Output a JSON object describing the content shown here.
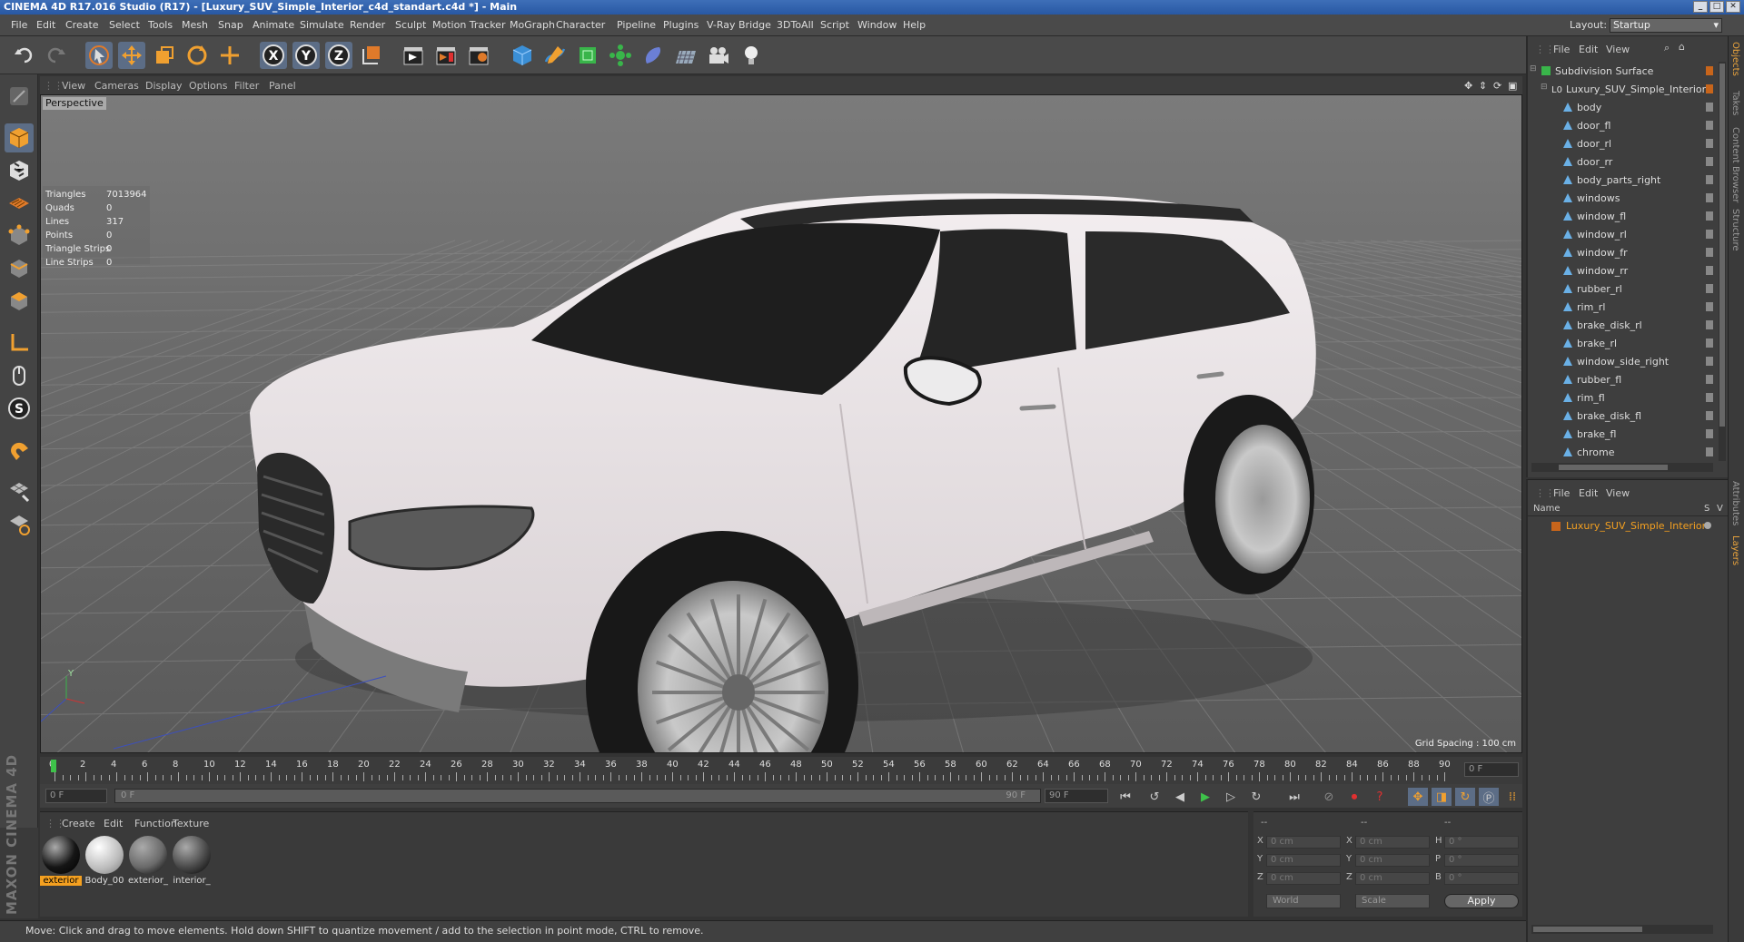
{
  "window": {
    "title": "CINEMA 4D R17.016 Studio (R17) - [Luxury_SUV_Simple_Interior_c4d_standart.c4d *] - Main",
    "min": "_",
    "max": "□",
    "close": "✕"
  },
  "menu": {
    "items": [
      "File",
      "Edit",
      "Create",
      "Select",
      "Tools",
      "Mesh",
      "Snap",
      "Animate",
      "Simulate",
      "Render",
      "Sculpt",
      "Motion Tracker",
      "MoGraph",
      "Character",
      "Pipeline",
      "Plugins",
      "V-Ray Bridge",
      "3DToAll",
      "Script",
      "Window",
      "Help"
    ],
    "layout_label": "Layout:",
    "layout_value": "Startup"
  },
  "toolbar": {
    "icons": [
      "undo-icon",
      "redo-icon",
      "live-selection-icon",
      "move-icon",
      "scale-icon",
      "rotate-icon",
      "last-tool-icon",
      "x-axis-icon",
      "y-axis-icon",
      "z-axis-icon",
      "coordinate-system-icon",
      "render-view-icon",
      "render-picture-viewer-icon",
      "edit-render-settings-icon",
      "cube-icon",
      "pen-spline-icon",
      "subdivision-surface-icon",
      "cloner-icon",
      "deformer-icon",
      "floor-icon",
      "camera-icon",
      "light-icon"
    ],
    "x_label": "X",
    "y_label": "Y",
    "z_label": "Z"
  },
  "viewport_menu": [
    "View",
    "Cameras",
    "Display",
    "Options",
    "Filter",
    "Panel"
  ],
  "viewport": {
    "label": "Perspective",
    "stats": [
      {
        "name": "Triangles",
        "value": "7013964"
      },
      {
        "name": "Quads",
        "value": "0"
      },
      {
        "name": "Lines",
        "value": "317"
      },
      {
        "name": "Points",
        "value": "0"
      },
      {
        "name": "Triangle Strips",
        "value": "0"
      },
      {
        "name": "Line Strips",
        "value": "0"
      }
    ],
    "grid_spacing": "Grid Spacing : 100 cm",
    "axis_y": "Y"
  },
  "timeline": {
    "ticks": [
      "0",
      "2",
      "4",
      "6",
      "8",
      "10",
      "12",
      "14",
      "16",
      "18",
      "20",
      "22",
      "24",
      "26",
      "28",
      "30",
      "32",
      "34",
      "36",
      "38",
      "40",
      "42",
      "44",
      "46",
      "48",
      "50",
      "52",
      "54",
      "56",
      "58",
      "60",
      "62",
      "64",
      "66",
      "68",
      "70",
      "72",
      "74",
      "76",
      "78",
      "80",
      "82",
      "84",
      "86",
      "88",
      "90"
    ],
    "current_frame": "0 F"
  },
  "playbar": {
    "start": "0 F",
    "slider_start": "0 F",
    "slider_end": "90 F",
    "end": "90 F"
  },
  "material_menu": [
    "Create",
    "Edit",
    "Function",
    "Texture"
  ],
  "materials": [
    {
      "name": "exterior",
      "color": "#151515",
      "selected": true
    },
    {
      "name": "Body_00",
      "color": "#e4e4e4",
      "selected": false
    },
    {
      "name": "exterior_",
      "color": "#6a6a6a",
      "selected": false
    },
    {
      "name": "interior_",
      "color": "#4a4a4a",
      "selected": false
    }
  ],
  "coords": {
    "header": [
      "--",
      "--",
      "--"
    ],
    "rows": [
      {
        "a": "X",
        "av": "0 cm",
        "b": "X",
        "bv": "0 cm",
        "c": "H",
        "cv": "0 °"
      },
      {
        "a": "Y",
        "av": "0 cm",
        "b": "Y",
        "bv": "0 cm",
        "c": "P",
        "cv": "0 °"
      },
      {
        "a": "Z",
        "av": "0 cm",
        "b": "Z",
        "bv": "0 cm",
        "c": "B",
        "cv": "0 °"
      }
    ],
    "world": "World",
    "scale": "Scale",
    "apply": "Apply"
  },
  "logo": "MAXON CINEMA 4D",
  "status": "Move: Click and drag to move elements. Hold down SHIFT to quantize movement / add to the selection in point mode, CTRL to remove.",
  "object_manager": {
    "menu": [
      "File",
      "Edit",
      "View"
    ],
    "objects": [
      {
        "name": "Subdivision Surface",
        "indent": 0
      },
      {
        "name": "Luxury_SUV_Simple_Interior",
        "indent": 1
      },
      {
        "name": "body",
        "indent": 2
      },
      {
        "name": "door_fl",
        "indent": 2
      },
      {
        "name": "door_rl",
        "indent": 2
      },
      {
        "name": "door_rr",
        "indent": 2
      },
      {
        "name": "body_parts_right",
        "indent": 2
      },
      {
        "name": "windows",
        "indent": 2
      },
      {
        "name": "window_fl",
        "indent": 2
      },
      {
        "name": "window_rl",
        "indent": 2
      },
      {
        "name": "window_fr",
        "indent": 2
      },
      {
        "name": "window_rr",
        "indent": 2
      },
      {
        "name": "rubber_rl",
        "indent": 2
      },
      {
        "name": "rim_rl",
        "indent": 2
      },
      {
        "name": "brake_disk_rl",
        "indent": 2
      },
      {
        "name": "brake_rl",
        "indent": 2
      },
      {
        "name": "window_side_right",
        "indent": 2
      },
      {
        "name": "rubber_fl",
        "indent": 2
      },
      {
        "name": "rim_fl",
        "indent": 2
      },
      {
        "name": "brake_disk_fl",
        "indent": 2
      },
      {
        "name": "brake_fl",
        "indent": 2
      },
      {
        "name": "chrome",
        "indent": 2
      }
    ]
  },
  "layer_manager": {
    "menu": [
      "File",
      "Edit",
      "View"
    ],
    "col_name": "Name",
    "col_s": "S",
    "col_v": "V",
    "layer": "Luxury_SUV_Simple_Interior",
    "layer_color": "#c8651b"
  },
  "side_tabs": [
    "Objects",
    "Takes",
    "Content Browser",
    "Structure",
    "Attributes",
    "Layers"
  ],
  "colors": {
    "accent": "#e8a33d",
    "selection": "#f4a020",
    "title": "#2f62ad"
  }
}
